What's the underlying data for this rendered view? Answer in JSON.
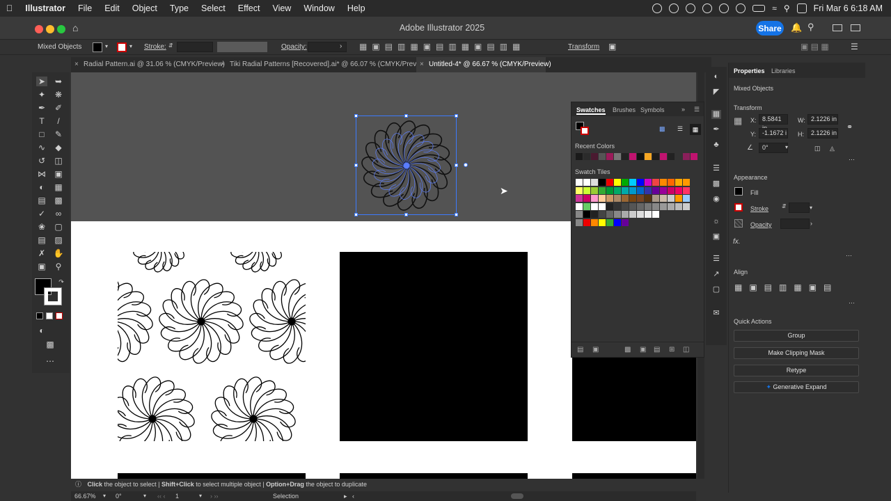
{
  "menubar": {
    "app": "Illustrator",
    "items": [
      "File",
      "Edit",
      "Object",
      "Type",
      "Select",
      "Effect",
      "View",
      "Window",
      "Help"
    ],
    "clock": "Fri Mar 6  6:18 AM"
  },
  "window": {
    "title": "Adobe Illustrator 2025",
    "share": "Share"
  },
  "control": {
    "selection": "Mixed Objects",
    "stroke_label": "Stroke:",
    "opacity_label": "Opacity:",
    "transform": "Transform"
  },
  "tabs": [
    {
      "label": "Radial Pattern.ai @ 31.06 % (CMYK/Preview)"
    },
    {
      "label": "Tiki Radial Patterns [Recovered].ai* @ 66.07 % (CMYK/Preview)"
    },
    {
      "label": "Untitled-4* @ 66.67 % (CMYK/Preview)"
    }
  ],
  "swatches": {
    "tabs": [
      "Swatches",
      "Brushes",
      "Symbols"
    ],
    "recent_colors": "Recent Colors",
    "swatch_tiles": "Swatch Tiles"
  },
  "properties": {
    "tabs": [
      "Properties",
      "Libraries"
    ],
    "selection": "Mixed Objects",
    "transform": "Transform",
    "x_label": "X:",
    "x_value": "8.5841 in",
    "y_label": "Y:",
    "y_value": "-1.1672 i",
    "w_label": "W:",
    "w_value": "2.1226 in",
    "h_label": "H:",
    "h_value": "2.1226 in",
    "angle": "0°",
    "appearance": "Appearance",
    "fill": "Fill",
    "stroke": "Stroke",
    "opacity": "Opacity",
    "fx": "fx.",
    "align": "Align",
    "quick_actions": "Quick Actions",
    "actions": [
      "Group",
      "Make Clipping Mask",
      "Retype",
      "Generative Expand"
    ]
  },
  "hint": {
    "a_bold": "Click",
    "a_text": " the object to select",
    "b_bold": "Shift+Click",
    "b_text": " to select multiple object",
    "c_bold": "Option+Drag",
    "c_text": " the object to duplicate"
  },
  "status": {
    "zoom": "66.67%",
    "rotate": "0°",
    "artboard": "1",
    "tool": "Selection"
  },
  "colors": {
    "accent": "#1473e6",
    "selection": "#3d7bff"
  }
}
